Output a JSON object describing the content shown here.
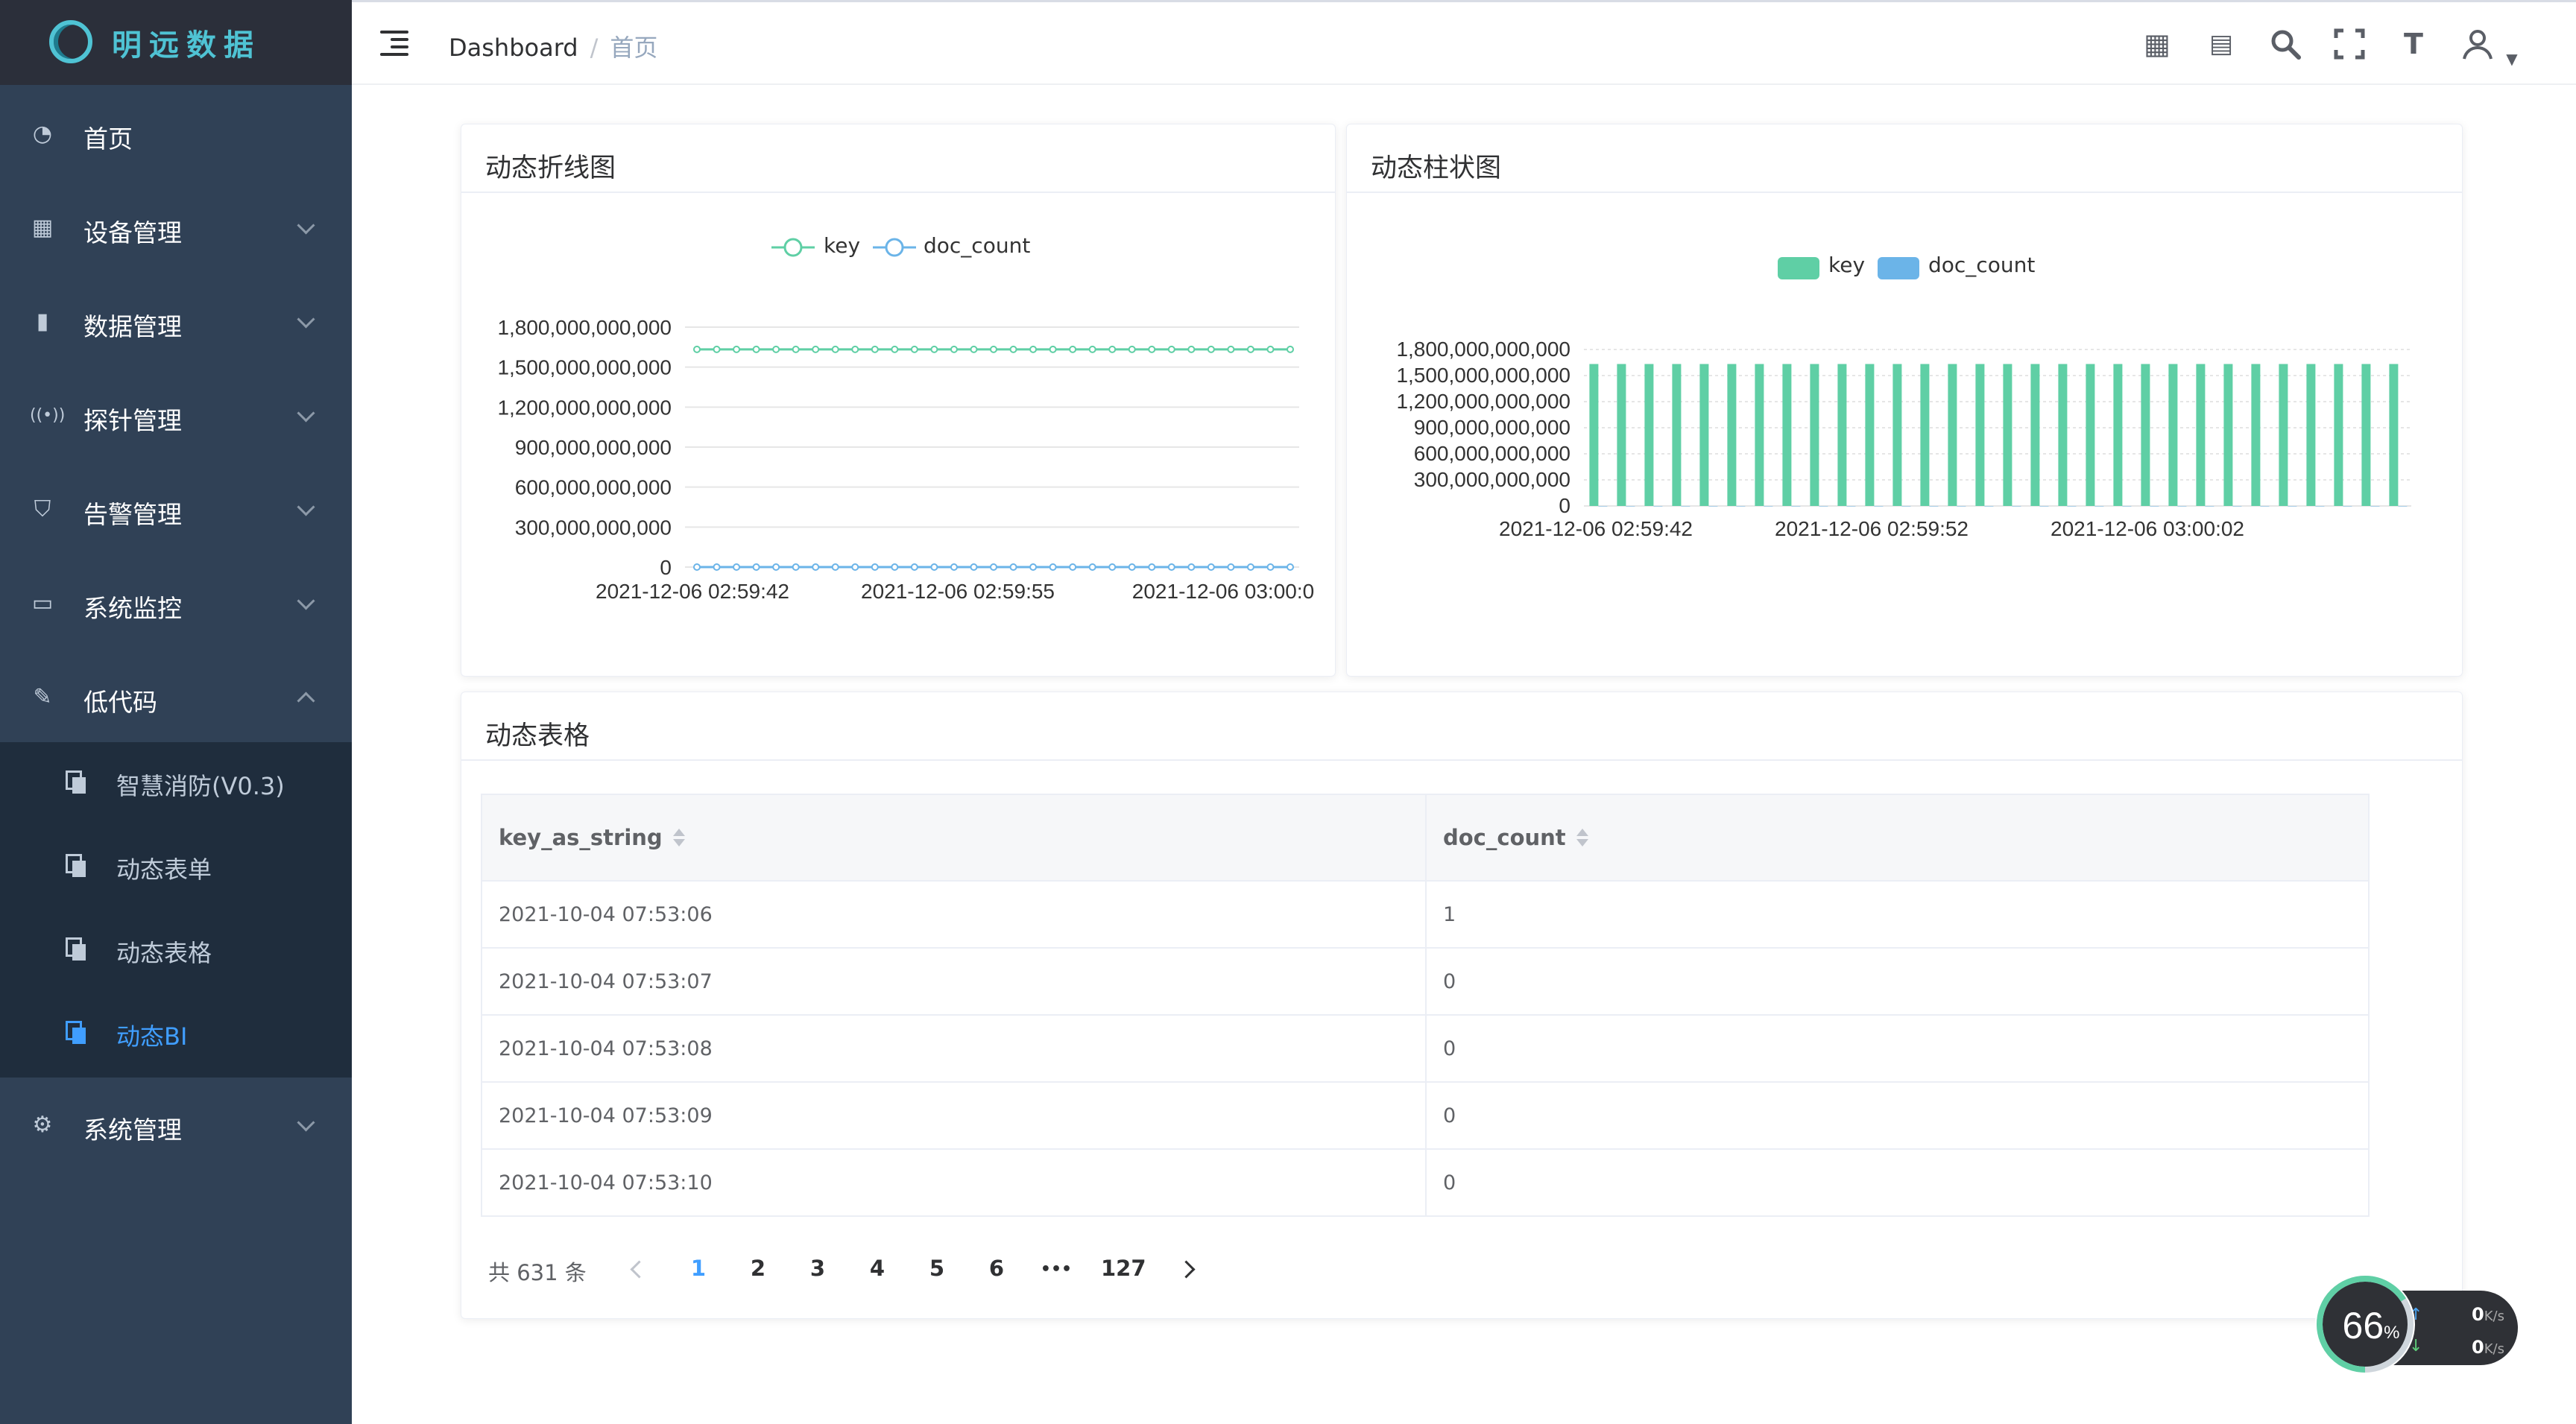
{
  "brand": {
    "name": "明远数据"
  },
  "sidebar": {
    "items": [
      {
        "label": "首页",
        "icon": "dashboard-icon"
      },
      {
        "label": "设备管理",
        "icon": "grid-icon"
      },
      {
        "label": "数据管理",
        "icon": "book-icon"
      },
      {
        "label": "探针管理",
        "icon": "signal-icon"
      },
      {
        "label": "告警管理",
        "icon": "shield-icon"
      },
      {
        "label": "系统监控",
        "icon": "monitor-icon"
      },
      {
        "label": "低代码",
        "icon": "edit-icon"
      }
    ],
    "submenu": [
      {
        "label": "智慧消防(V0.3)"
      },
      {
        "label": "动态表单"
      },
      {
        "label": "动态表格"
      },
      {
        "label": "动态BI"
      }
    ],
    "system": {
      "label": "系统管理",
      "icon": "gear-icon"
    }
  },
  "header": {
    "breadcrumb": [
      "Dashboard",
      "首页"
    ],
    "icons": [
      "grid-icon",
      "message-icon",
      "search-icon",
      "fullscreen-icon",
      "font-size-icon",
      "user-icon"
    ]
  },
  "line_card": {
    "title": "动态折线图",
    "legend": [
      "key",
      "doc_count"
    ]
  },
  "bar_card": {
    "title": "动态柱状图",
    "legend": [
      "key",
      "doc_count"
    ]
  },
  "chart_data": [
    {
      "type": "line",
      "title": "动态折线图",
      "series": [
        {
          "name": "key",
          "color": "#5fcfa5",
          "values": [
            1633000000000,
            1633000000000,
            1633000000000,
            1633000000000,
            1633000000000,
            1633000000000,
            1633000000000,
            1633000000000,
            1633000000000,
            1633000000000,
            1633000000000,
            1633000000000,
            1633000000000,
            1633000000000,
            1633000000000,
            1633000000000,
            1633000000000,
            1633000000000,
            1633000000000,
            1633000000000,
            1633000000000,
            1633000000000,
            1633000000000,
            1633000000000,
            1633000000000,
            1633000000000,
            1633000000000,
            1633000000000,
            1633000000000,
            1633000000000,
            1633000000000
          ]
        },
        {
          "name": "doc_count",
          "color": "#6bb4e8",
          "values": [
            0,
            0,
            0,
            0,
            0,
            0,
            0,
            0,
            0,
            0,
            0,
            0,
            0,
            0,
            0,
            0,
            0,
            0,
            0,
            0,
            0,
            0,
            0,
            0,
            0,
            0,
            0,
            0,
            0,
            0,
            0
          ]
        }
      ],
      "x_ticks": [
        "2021-12-06 02:59:42",
        "2021-12-06 02:59:55",
        "2021-12-06 03:00:0"
      ],
      "y_ticks": [
        "0",
        "300,000,000,000",
        "600,000,000,000",
        "900,000,000,000",
        "1,200,000,000,000",
        "1,500,000,000,000",
        "1,800,000,000,000"
      ],
      "ylim": [
        0,
        1800000000000
      ]
    },
    {
      "type": "bar",
      "title": "动态柱状图",
      "series": [
        {
          "name": "key",
          "color": "#5fcfa5",
          "values": [
            1633000000000,
            1633000000000,
            1633000000000,
            1633000000000,
            1633000000000,
            1633000000000,
            1633000000000,
            1633000000000,
            1633000000000,
            1633000000000,
            1633000000000,
            1633000000000,
            1633000000000,
            1633000000000,
            1633000000000,
            1633000000000,
            1633000000000,
            1633000000000,
            1633000000000,
            1633000000000,
            1633000000000,
            1633000000000,
            1633000000000,
            1633000000000,
            1633000000000,
            1633000000000,
            1633000000000,
            1633000000000,
            1633000000000,
            1633000000000
          ]
        },
        {
          "name": "doc_count",
          "color": "#6bb4e8",
          "values": [
            0,
            0,
            0,
            0,
            0,
            0,
            0,
            0,
            0,
            0,
            0,
            0,
            0,
            0,
            0,
            0,
            0,
            0,
            0,
            0,
            0,
            0,
            0,
            0,
            0,
            0,
            0,
            0,
            0,
            0
          ]
        }
      ],
      "x_ticks": [
        "2021-12-06 02:59:42",
        "2021-12-06 02:59:52",
        "2021-12-06 03:00:02"
      ],
      "y_ticks": [
        "0",
        "300,000,000,000",
        "600,000,000,000",
        "900,000,000,000",
        "1,200,000,000,000",
        "1,500,000,000,000",
        "1,800,000,000,000"
      ],
      "ylim": [
        0,
        1800000000000
      ]
    }
  ],
  "table_card": {
    "title": "动态表格",
    "columns": [
      "key_as_string",
      "doc_count"
    ],
    "rows": [
      [
        "2021-10-04 07:53:06",
        "1"
      ],
      [
        "2021-10-04 07:53:07",
        "0"
      ],
      [
        "2021-10-04 07:53:08",
        "0"
      ],
      [
        "2021-10-04 07:53:09",
        "0"
      ],
      [
        "2021-10-04 07:53:10",
        "0"
      ]
    ]
  },
  "pagination": {
    "total": "共 631 条",
    "pages": [
      "1",
      "2",
      "3",
      "4",
      "5",
      "6",
      "•••",
      "127"
    ],
    "current": "1"
  },
  "net_widget": {
    "percent": "66",
    "percent_unit": "%",
    "upload": "0",
    "download": "0",
    "unit": "K/s"
  }
}
